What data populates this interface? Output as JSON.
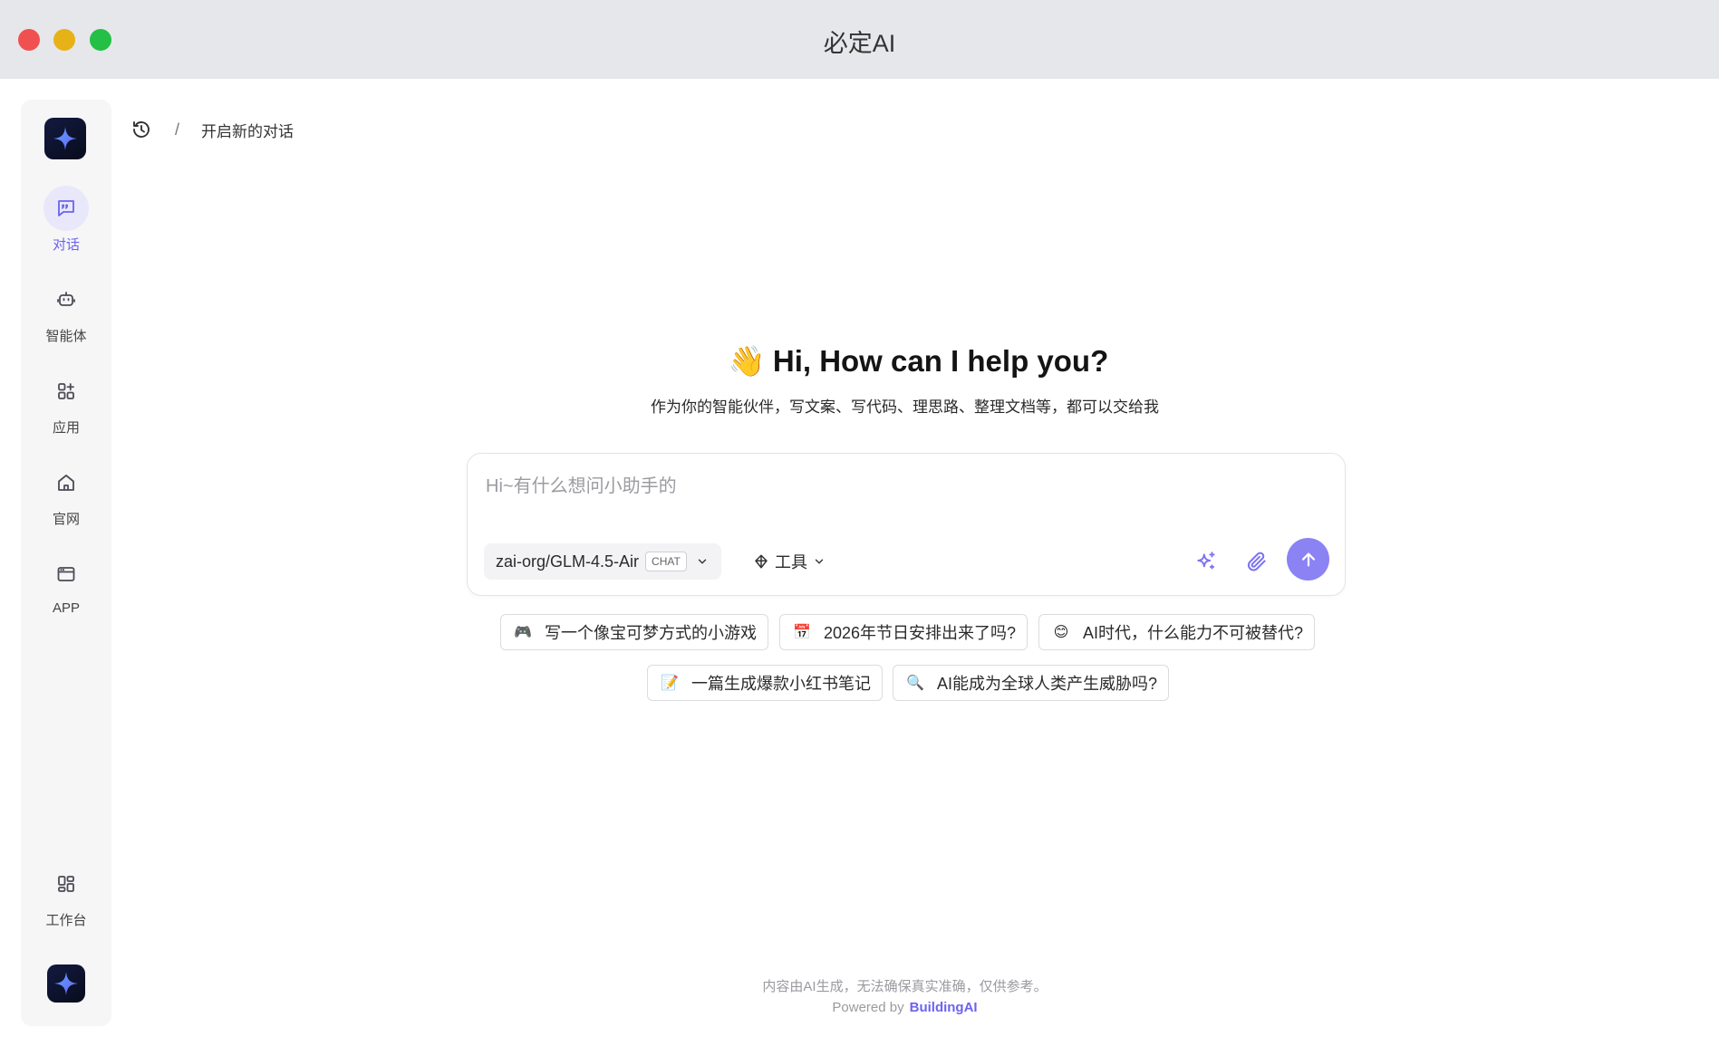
{
  "window": {
    "title": "必定AI"
  },
  "sidebar": {
    "items": [
      {
        "label": "对话",
        "icon": "chat-icon",
        "active": true
      },
      {
        "label": "智能体",
        "icon": "robot-icon",
        "active": false
      },
      {
        "label": "应用",
        "icon": "apps-icon",
        "active": false
      },
      {
        "label": "官网",
        "icon": "home-icon",
        "active": false
      },
      {
        "label": "APP",
        "icon": "app-window-icon",
        "active": false
      }
    ],
    "workspace": {
      "label": "工作台",
      "icon": "workspace-grid-icon"
    }
  },
  "breadcrumb": {
    "separator": "/",
    "current": "开启新的对话"
  },
  "hero": {
    "emoji": "👋",
    "title": "Hi, How can I help you?",
    "subtitle": "作为你的智能伙伴，写文案、写代码、理思路、整理文档等，都可以交给我"
  },
  "composer": {
    "placeholder": "Hi~有什么想问小助手的",
    "value": "",
    "model": {
      "name": "zai-org/GLM-4.5-Air",
      "badge": "CHAT"
    },
    "tools_label": "工具"
  },
  "suggestions": [
    {
      "emoji": "🎮",
      "label": "写一个像宝可梦方式的小游戏"
    },
    {
      "emoji": "📅",
      "label": "2026年节日安排出来了吗?"
    },
    {
      "emoji": "😊",
      "label": "AI时代，什么能力不可被替代?"
    },
    {
      "emoji": "📝",
      "label": "一篇生成爆款小红书笔记"
    },
    {
      "emoji": "🔍",
      "label": "AI能成为全球人类产生威胁吗?"
    }
  ],
  "footer": {
    "disclaimer": "内容由AI生成，无法确保真实准确，仅供参考。",
    "powered_prefix": "Powered by",
    "brand": "BuildingAI"
  },
  "colors": {
    "accent": "#6c63ee",
    "send_button": "#8b82f4",
    "active_bg": "#e9e8fb"
  }
}
